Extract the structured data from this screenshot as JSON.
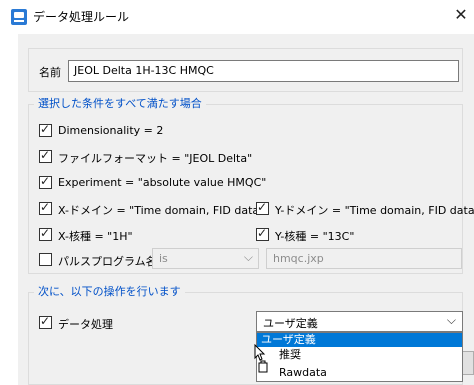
{
  "window": {
    "title": "データ処理ルール",
    "close_glyph": "✕"
  },
  "name_field": {
    "label": "名前",
    "value": "JEOL Delta 1H-13C HMQC"
  },
  "conditions": {
    "group_title": "選択した条件をすべて満たす場合",
    "items": [
      {
        "label": "Dimensionality = 2",
        "checked": true
      },
      {
        "label": "ファイルフォーマット = \"JEOL Delta\"",
        "checked": true
      },
      {
        "label": "Experiment = \"absolute value HMQC\"",
        "checked": true
      },
      {
        "label": "X-ドメイン = \"Time domain, FID data\"",
        "checked": true
      },
      {
        "label": "Y-ドメイン = \"Time domain, FID data\"",
        "checked": true
      },
      {
        "label": "X-核種 = \"1H\"",
        "checked": true
      },
      {
        "label": "Y-核種 = \"13C\"",
        "checked": true
      },
      {
        "label": "パルスプログラム名",
        "checked": false
      }
    ],
    "pulse_operator": "is",
    "pulse_value": "hmqc.jxp"
  },
  "actions": {
    "group_title": "次に、以下の操作を行います",
    "data_processing_label": "データ処理",
    "data_processing_checked": true,
    "method_selected": "ユーザ定義",
    "method_options": [
      "ユーザ定義",
      "推奨",
      "Rawdata"
    ]
  },
  "icons": {
    "close": "close-icon",
    "app": "app-icon",
    "chevron": "chevron-down-icon"
  },
  "colors": {
    "group_title": "#0050c8",
    "selection": "#0078d7"
  }
}
